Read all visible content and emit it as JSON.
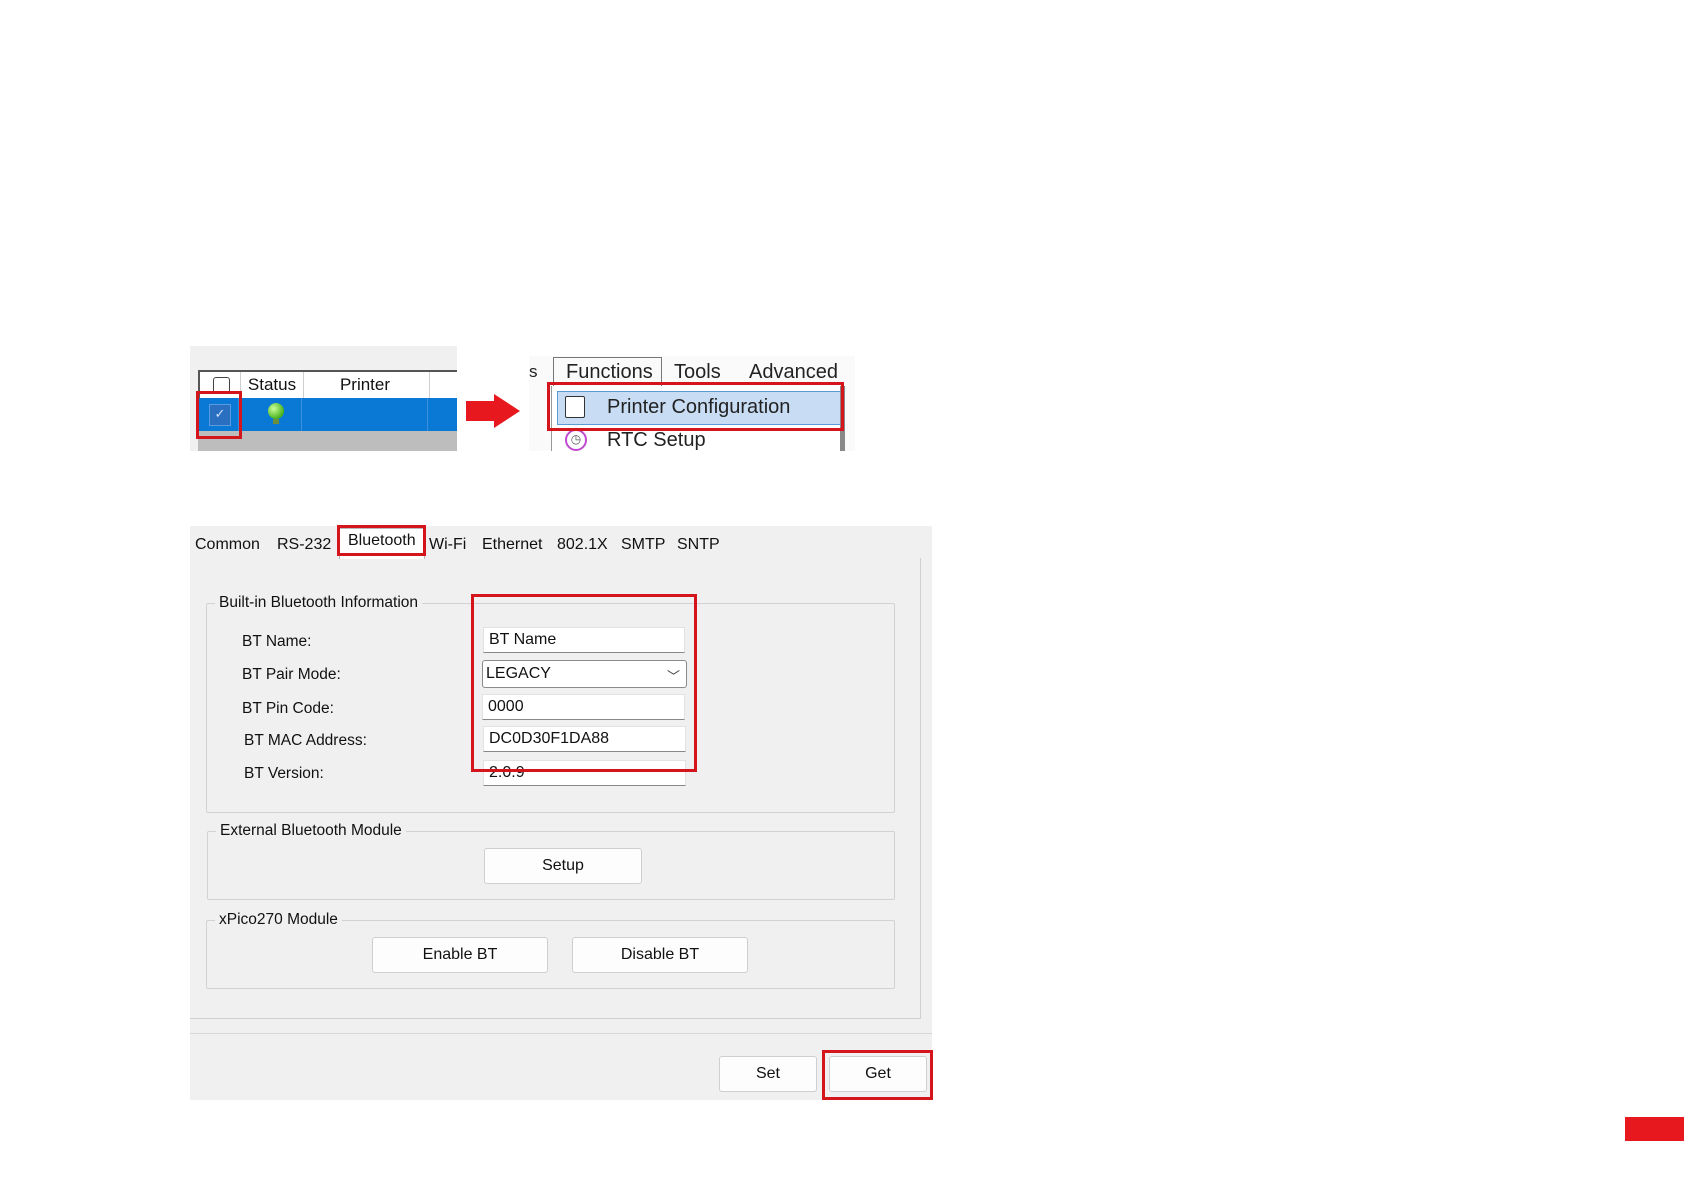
{
  "printer_list": {
    "columns": [
      "Status",
      "Printer"
    ]
  },
  "menu": {
    "left_fragment": "s",
    "bar": [
      "Functions",
      "Tools",
      "Advanced"
    ],
    "items": [
      "Printer Configuration",
      "RTC Setup"
    ]
  },
  "dialog": {
    "tabs": [
      "Common",
      "RS-232",
      "Bluetooth",
      "Wi-Fi",
      "Ethernet",
      "802.1X",
      "SMTP",
      "SNTP"
    ],
    "active_tab": "Bluetooth",
    "builtin": {
      "title": "Built-in Bluetooth Information",
      "labels": {
        "name": "BT Name:",
        "pair_mode": "BT Pair Mode:",
        "pin_code": "BT Pin Code:",
        "mac": "BT MAC Address:",
        "version": "BT Version:"
      },
      "values": {
        "name": "BT Name",
        "pair_mode": "LEGACY",
        "pin_code": "0000",
        "mac": "DC0D30F1DA88",
        "version": "2.0.9"
      }
    },
    "external": {
      "title": "External Bluetooth Module",
      "setup_label": "Setup"
    },
    "xpico": {
      "title": "xPico270 Module",
      "enable_label": "Enable BT",
      "disable_label": "Disable BT"
    },
    "footer": {
      "set_label": "Set",
      "get_label": "Get"
    }
  },
  "colors": {
    "highlight_red": "#d4161c",
    "selection_blue": "#0a79d6",
    "menu_highlight": "#c8ddf4"
  }
}
